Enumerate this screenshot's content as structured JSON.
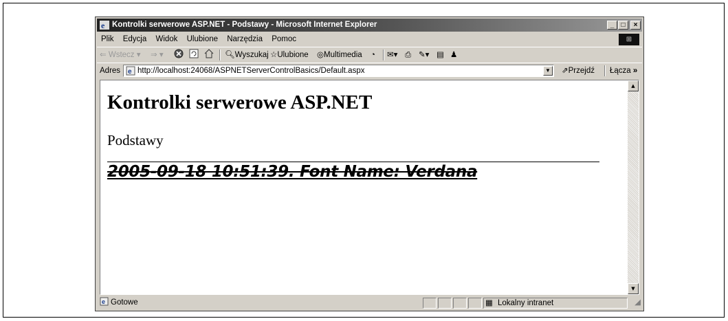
{
  "window": {
    "title": "Kontrolki serwerowe ASP.NET - Podstawy - Microsoft Internet Explorer",
    "minimize": "_",
    "maximize": "□",
    "close": "×"
  },
  "menu": [
    "Plik",
    "Edycja",
    "Widok",
    "Ulubione",
    "Narzędzia",
    "Pomoc"
  ],
  "toolbar": {
    "back": "Wstecz",
    "search": "Wyszukaj",
    "favorites": "Ulubione",
    "media": "Multimedia"
  },
  "address": {
    "label": "Adres",
    "url": "http://localhost:24068/ASPNETServerControlBasics/Default.aspx",
    "go": "Przejdź",
    "links": "Łącza"
  },
  "page": {
    "heading": "Kontrolki serwerowe ASP.NET",
    "subheading": "Podstawy",
    "stamp": "2005-09-18 10:51:39. Font Name: Verdana"
  },
  "status": {
    "text": "Gotowe",
    "zone": "Lokalny intranet"
  },
  "icons": [
    "ie-logo-icon",
    "back-arrow-icon",
    "forward-arrow-icon",
    "stop-icon",
    "refresh-icon",
    "home-icon",
    "search-icon",
    "favorites-icon",
    "media-icon",
    "history-icon",
    "mail-icon",
    "print-icon",
    "edit-icon",
    "discuss-icon",
    "messenger-icon",
    "go-arrow-icon",
    "page-icon",
    "intranet-icon",
    "resize-grip-icon"
  ]
}
